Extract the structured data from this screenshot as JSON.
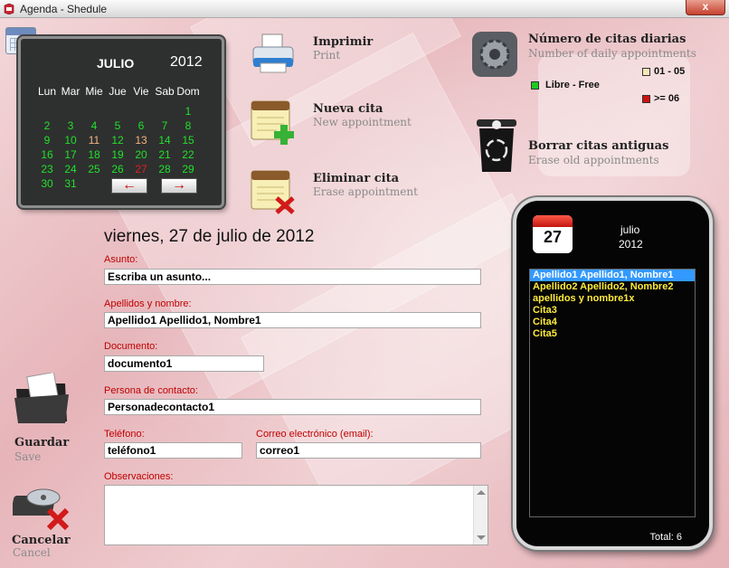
{
  "window": {
    "title": "Agenda - Shedule",
    "close_label": "x"
  },
  "calendar": {
    "month": "JULIO",
    "year": "2012",
    "weekdays": [
      "Lun",
      "Mar",
      "Mie",
      "Jue",
      "Vie",
      "Sab",
      "Dom"
    ],
    "weeks": [
      [
        "",
        "",
        "",
        "",
        "",
        "",
        "1"
      ],
      [
        "2",
        "3",
        "4",
        "5",
        "6",
        "7",
        "8"
      ],
      [
        "9",
        "10",
        "11",
        "12",
        "13",
        "14",
        "15"
      ],
      [
        "16",
        "17",
        "18",
        "19",
        "20",
        "21",
        "22"
      ],
      [
        "23",
        "24",
        "25",
        "26",
        "27",
        "28",
        "29"
      ],
      [
        "30",
        "31",
        "",
        "",
        "",
        "",
        ""
      ]
    ],
    "busy_days": [
      "11",
      "13"
    ],
    "full_days": [
      "27"
    ],
    "prev_label": "←",
    "next_label": "→",
    "colors": {
      "free": "#21e02b",
      "busy": "#f2b483",
      "full": "#e02020"
    }
  },
  "actions": {
    "print": {
      "label": "Imprimir",
      "sub": "Print"
    },
    "new": {
      "label": "Nueva cita",
      "sub": "New appointment"
    },
    "erase": {
      "label": "Eliminar cita",
      "sub": "Erase appointment"
    },
    "daily": {
      "label": "Número de citas diarias",
      "sub": "Number of daily appointments"
    },
    "delete_old": {
      "label": "Borrar citas antiguas",
      "sub": "Erase old appointments"
    }
  },
  "legend": {
    "free": "Libre - Free",
    "range1": "01 - 05",
    "range2": ">= 06",
    "free_color": "#1ecb1e",
    "range1_color": "#f8e6b8",
    "range2_color": "#d01010"
  },
  "form": {
    "date_title": "viernes, 27 de julio de 2012",
    "asunto_label": "Asunto:",
    "asunto_value": "Escriba un asunto...",
    "nombre_label": "Apellidos y nombre:",
    "nombre_value": "Apellido1 Apellido1, Nombre1",
    "documento_label": "Documento:",
    "documento_value": "documento1",
    "contacto_label": "Persona de contacto:",
    "contacto_value": "Personadecontacto1",
    "telefono_label": "Teléfono:",
    "telefono_value": "teléfono1",
    "correo_label": "Correo electrónico (email):",
    "correo_value": "correo1",
    "observaciones_label": "Observaciones:"
  },
  "side": {
    "save": {
      "label": "Guardar",
      "sub": "Save"
    },
    "cancel": {
      "label": "Cancelar",
      "sub": "Cancel"
    }
  },
  "phone": {
    "day": "27",
    "month": "julio",
    "year": "2012",
    "items": [
      "Apellido1 Apellido1, Nombre1",
      "Apellido2 Apellido2, Nombre2",
      "apellidos y nombre1x",
      "Cita3",
      "Cita4",
      "Cita5"
    ],
    "selected_index": 0,
    "total": "Total: 6"
  }
}
